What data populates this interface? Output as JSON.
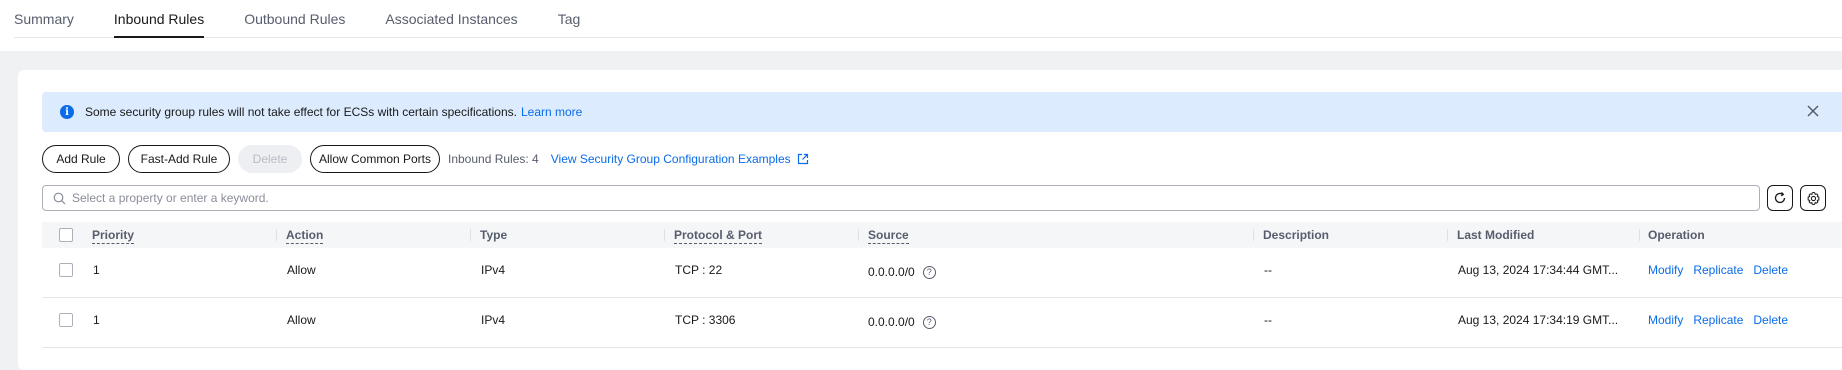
{
  "tabs": [
    "Summary",
    "Inbound Rules",
    "Outbound Rules",
    "Associated Instances",
    "Tag"
  ],
  "active_tab": 1,
  "notice": {
    "text": "Some security group rules will not take effect for ECSs with certain specifications.",
    "link": "Learn more"
  },
  "toolbar": {
    "add_rule": "Add Rule",
    "fast_add_rule": "Fast-Add Rule",
    "delete": "Delete",
    "allow_common_ports": "Allow Common Ports",
    "count_label": "Inbound Rules: 4",
    "examples_link": "View Security Group Configuration Examples"
  },
  "search": {
    "placeholder": "Select a property or enter a keyword."
  },
  "table": {
    "columns": [
      "Priority",
      "Action",
      "Type",
      "Protocol & Port",
      "Source",
      "Description",
      "Last Modified",
      "Operation"
    ],
    "rows": [
      {
        "priority": "1",
        "action": "Allow",
        "type": "IPv4",
        "protocol_port": "TCP : 22",
        "source": "0.0.0.0/0",
        "description": "--",
        "last_modified": "Aug 13, 2024 17:34:44 GMT...",
        "ops": [
          "Modify",
          "Replicate",
          "Delete"
        ]
      },
      {
        "priority": "1",
        "action": "Allow",
        "type": "IPv4",
        "protocol_port": "TCP : 3306",
        "source": "0.0.0.0/0",
        "description": "--",
        "last_modified": "Aug 13, 2024 17:34:19 GMT...",
        "ops": [
          "Modify",
          "Replicate",
          "Delete"
        ]
      }
    ]
  },
  "colors": {
    "accent": "#0a6ce8",
    "notice_bg": "#dcebfd"
  }
}
